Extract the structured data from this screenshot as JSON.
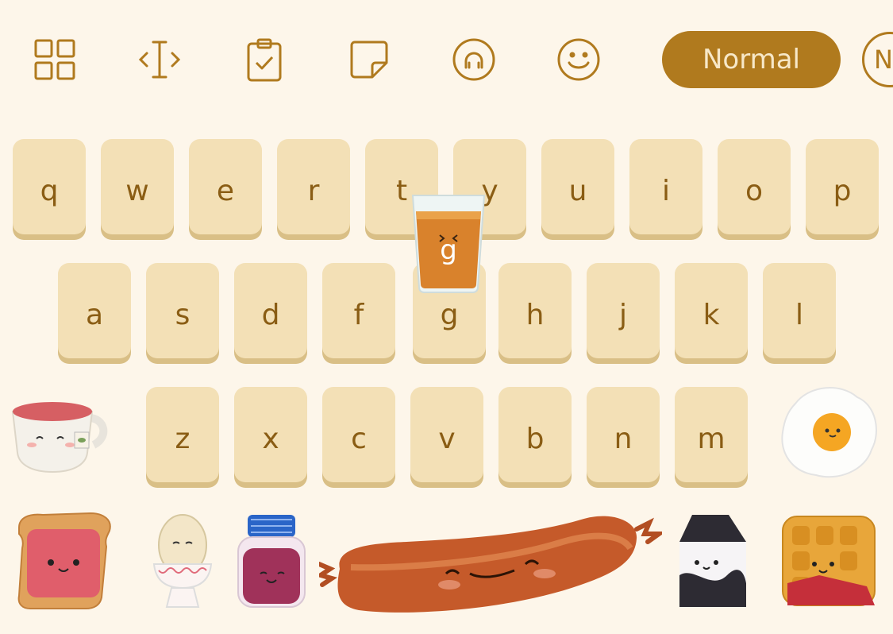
{
  "toolbar": {
    "icons": [
      {
        "name": "grid-icon"
      },
      {
        "name": "text-cursor-icon"
      },
      {
        "name": "clipboard-icon"
      },
      {
        "name": "sticker-icon"
      },
      {
        "name": "voice-icon"
      },
      {
        "name": "emoji-icon"
      }
    ],
    "mode_label": "Normal",
    "mode_circle_label": "N"
  },
  "keyboard": {
    "row1": [
      "q",
      "w",
      "e",
      "r",
      "t",
      "y",
      "u",
      "i",
      "o",
      "p"
    ],
    "row2": [
      "a",
      "s",
      "d",
      "f",
      "g",
      "h",
      "j",
      "k",
      "l"
    ],
    "row3": [
      "z",
      "x",
      "c",
      "v",
      "b",
      "n",
      "m"
    ]
  },
  "popup": {
    "label": "g"
  },
  "colors": {
    "background": "#fdf6ea",
    "key": "#f3e0b6",
    "key_text": "#8a5d14",
    "accent": "#b07a1e"
  },
  "decorations": [
    "tea-cup",
    "fried-egg",
    "jam-toast",
    "boiled-egg",
    "jam-jar",
    "sausage",
    "milk-carton",
    "waffle",
    "orange-juice-glass"
  ]
}
